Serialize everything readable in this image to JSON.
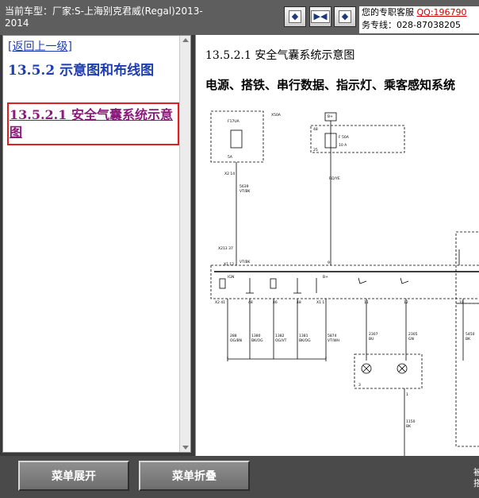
{
  "header": {
    "vehicle_label": "当前车型：厂家:S-上海别克君威(Regal)2013-2014",
    "nav_buttons": [
      {
        "glyph": "◆"
      },
      {
        "glyph": "▶◀"
      },
      {
        "glyph": "◆"
      }
    ],
    "service_line1": "您的专职客服",
    "service_qq": "QQ:196790",
    "service_line2": "务专线：028-87038205"
  },
  "left_pane": {
    "back_link": "[返回上一级]",
    "section_title": "13.5.2 示意图和布线图",
    "active_item": "13.5.2.1 安全气囊系统示意图"
  },
  "right_pane": {
    "title": "13.5.2.1 安全气囊系统示意图",
    "subtitle": "电源、搭铁、串行数据、指示灯、乘客感知系统"
  },
  "footer": {
    "expand_label": "菜单展开",
    "collapse_label": "菜单折叠",
    "edge_text": "被\n搭"
  }
}
